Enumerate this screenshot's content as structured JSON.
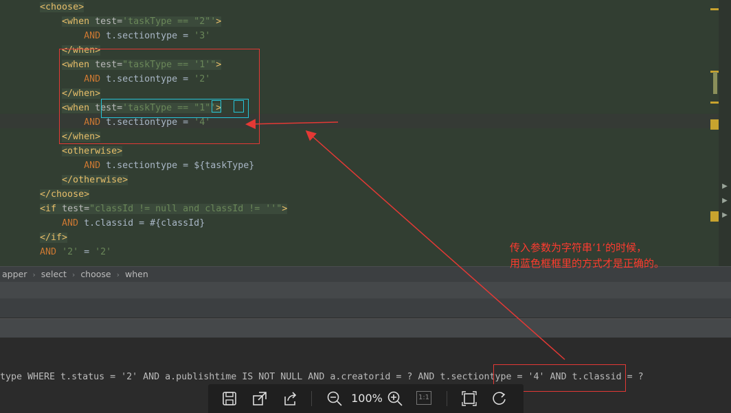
{
  "editor": {
    "lines": [
      [
        {
          "t": "    ",
          "c": "pl"
        },
        {
          "t": "<choose>",
          "c": "tag",
          "h": 1
        }
      ],
      [
        {
          "t": "        ",
          "c": "pl"
        },
        {
          "t": "<when ",
          "c": "tag",
          "h": 1
        },
        {
          "t": "test=",
          "c": "attr",
          "h": 1
        },
        {
          "t": "'taskType == \"2\"'",
          "c": "str",
          "h": 1
        },
        {
          "t": ">",
          "c": "tag",
          "h": 1
        }
      ],
      [
        {
          "t": "            ",
          "c": "pl"
        },
        {
          "t": "AND ",
          "c": "kw"
        },
        {
          "t": "t.sectiontype = ",
          "c": "pl"
        },
        {
          "t": "'3'",
          "c": "str"
        }
      ],
      [
        {
          "t": "        ",
          "c": "pl"
        },
        {
          "t": "</when>",
          "c": "tag",
          "h": 1
        }
      ],
      [
        {
          "t": "        ",
          "c": "pl"
        },
        {
          "t": "<when ",
          "c": "tag",
          "h": 1
        },
        {
          "t": "test=",
          "c": "attr",
          "h": 1
        },
        {
          "t": "\"taskType == '1'\"",
          "c": "str",
          "h": 1
        },
        {
          "t": ">",
          "c": "tag",
          "h": 1
        }
      ],
      [
        {
          "t": "            ",
          "c": "pl"
        },
        {
          "t": "AND ",
          "c": "kw"
        },
        {
          "t": "t.sectiontype = ",
          "c": "pl"
        },
        {
          "t": "'2'",
          "c": "str"
        }
      ],
      [
        {
          "t": "        ",
          "c": "pl"
        },
        {
          "t": "</when>",
          "c": "tag",
          "h": 1
        }
      ],
      [
        {
          "t": "        ",
          "c": "pl"
        },
        {
          "t": "<when ",
          "c": "tag",
          "h": 1
        },
        {
          "t": "test=",
          "c": "attr",
          "h": 1
        },
        {
          "t": "'taskType == \"1\"'",
          "c": "str",
          "h": 1
        },
        {
          "t": ">",
          "c": "tag",
          "h": 1
        }
      ],
      [
        {
          "t": "            ",
          "c": "pl"
        },
        {
          "t": "AND ",
          "c": "kw"
        },
        {
          "t": "t.sectiontype = ",
          "c": "pl"
        },
        {
          "t": "'4'",
          "c": "str"
        }
      ],
      [
        {
          "t": "        ",
          "c": "pl"
        },
        {
          "t": "</when>",
          "c": "tag",
          "h": 1
        }
      ],
      [
        {
          "t": "        ",
          "c": "pl"
        },
        {
          "t": "<otherwise>",
          "c": "tag",
          "h": 1
        }
      ],
      [
        {
          "t": "            ",
          "c": "pl"
        },
        {
          "t": "AND ",
          "c": "kw"
        },
        {
          "t": "t.sectiontype = ${taskType}",
          "c": "pl"
        }
      ],
      [
        {
          "t": "        ",
          "c": "pl"
        },
        {
          "t": "</otherwise>",
          "c": "tag",
          "h": 1
        }
      ],
      [
        {
          "t": "    ",
          "c": "pl"
        },
        {
          "t": "</choose>",
          "c": "tag",
          "h": 1
        }
      ],
      [
        {
          "t": "    ",
          "c": "pl"
        },
        {
          "t": "<if ",
          "c": "tag",
          "h": 1
        },
        {
          "t": "test=",
          "c": "attr",
          "h": 1
        },
        {
          "t": "\"classId != null and classId != ''\"",
          "c": "str",
          "h": 1
        },
        {
          "t": ">",
          "c": "tag",
          "h": 1
        }
      ],
      [
        {
          "t": "        ",
          "c": "pl"
        },
        {
          "t": "AND ",
          "c": "kw"
        },
        {
          "t": "t.classid = #{classId}",
          "c": "pl"
        }
      ],
      [
        {
          "t": "    ",
          "c": "pl"
        },
        {
          "t": "</if>",
          "c": "tag",
          "h": 1
        }
      ],
      [
        {
          "t": "    ",
          "c": "pl"
        },
        {
          "t": "AND ",
          "c": "kw"
        },
        {
          "t": "'2'",
          "c": "str"
        },
        {
          "t": " = ",
          "c": "pl"
        },
        {
          "t": "'2'",
          "c": "str"
        }
      ]
    ]
  },
  "breadcrumb": [
    "apper",
    "select",
    "choose",
    "when"
  ],
  "console": {
    "sql_parts": [
      "type WHERE t.status = '2' AND a.publishtime IS NOT NULL AND a.creatorid = ? AND ",
      "t.sectiontype = '4'",
      " AND t.classid = ?"
    ]
  },
  "annotation": {
    "line1": "传入参数为字符串‘1’的时候，",
    "line2": "用蓝色框框里的方式才是正确的。"
  },
  "toolbar": {
    "zoom": "100%",
    "actual_size": "1:1"
  },
  "colors": {
    "editor_bg": "#323e32",
    "annotation": "#e53935",
    "highlight_box": "#26c6da"
  }
}
